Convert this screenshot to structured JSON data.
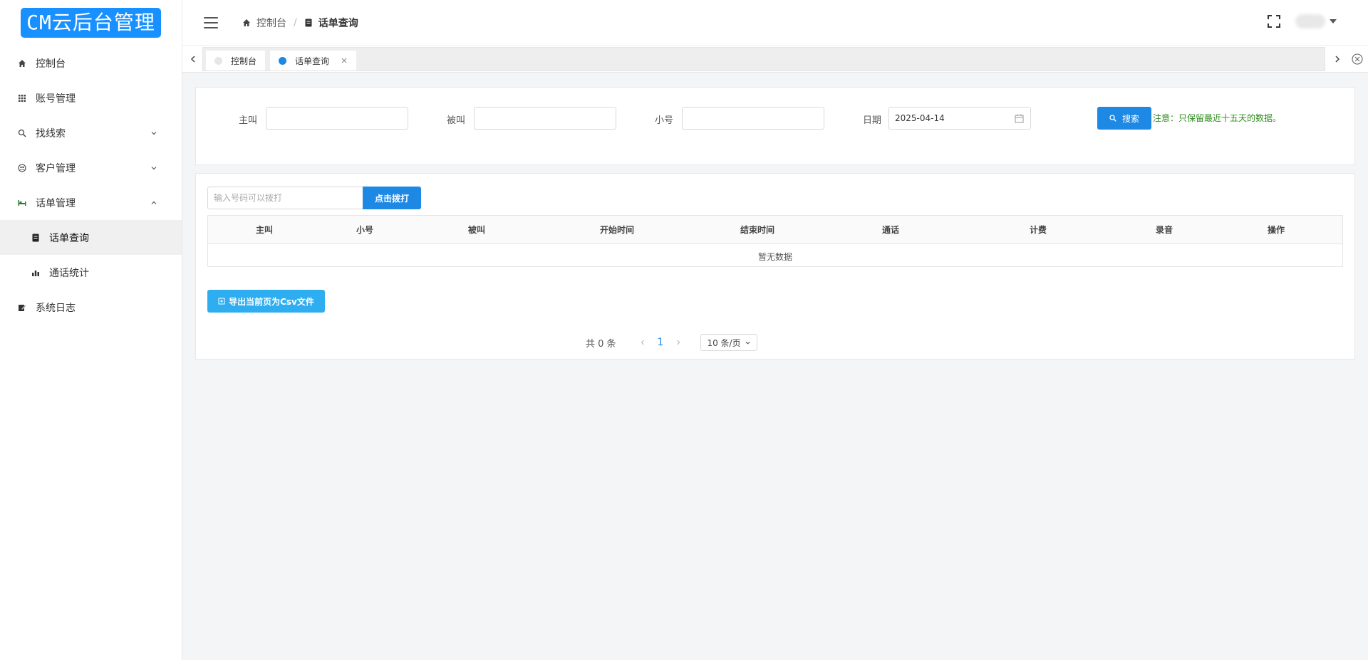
{
  "app": {
    "logo": "CM云后台管理"
  },
  "sidebar": {
    "items": [
      {
        "label": "控制台",
        "icon": "home-icon"
      },
      {
        "label": "账号管理",
        "icon": "grid-icon"
      },
      {
        "label": "找线索",
        "icon": "search-icon",
        "expandable": true
      },
      {
        "label": "客户管理",
        "icon": "users-icon",
        "expandable": true
      },
      {
        "label": "话单管理",
        "icon": "bed-icon",
        "expanded": true
      },
      {
        "label": "话单查询",
        "icon": "document-icon",
        "sub": true,
        "active": true
      },
      {
        "label": "通话统计",
        "icon": "bar-chart-icon",
        "sub": true
      },
      {
        "label": "系统日志",
        "icon": "edit-log-icon"
      }
    ]
  },
  "header": {
    "breadcrumb": {
      "home": "控制台",
      "separator": "/",
      "current": "话单查询"
    }
  },
  "tabs": [
    {
      "label": "控制台",
      "active": false
    },
    {
      "label": "话单查询",
      "active": true
    }
  ],
  "search": {
    "caller_label": "主叫",
    "callee_label": "被叫",
    "small_label": "小号",
    "date_label": "日期",
    "date_value": "2025-04-14",
    "search_button": "搜索",
    "notice": "注意：只保留最近十五天的数据。"
  },
  "dial": {
    "placeholder": "输入号码可以拨打",
    "button": "点击拨打"
  },
  "table": {
    "columns": [
      "主叫",
      "小号",
      "被叫",
      "开始时间",
      "结束时间",
      "通话",
      "计费",
      "录音",
      "操作"
    ],
    "empty_text": "暂无数据"
  },
  "export_button": "导出当前页为Csv文件",
  "pagination": {
    "total": "共 0 条",
    "current_page": "1",
    "page_size": "10 条/页"
  },
  "colors": {
    "primary": "#1e88e5",
    "logo_bg": "#1890ff",
    "notice": "#2e8b1e",
    "export": "#2eaef0"
  }
}
